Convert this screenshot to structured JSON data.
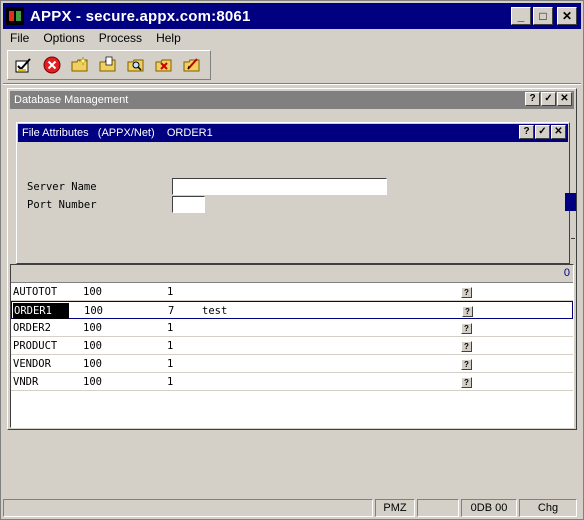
{
  "window": {
    "title": "APPX - secure.appx.com:8061",
    "minimize": "_",
    "maximize": "□",
    "close": "✕"
  },
  "menu": [
    {
      "label": "File"
    },
    {
      "label": "Options"
    },
    {
      "label": "Process"
    },
    {
      "label": "Help"
    }
  ],
  "toolbar": {
    "icons": [
      "confirm-icon",
      "cancel-icon",
      "folder-new-icon",
      "folder-open-icon",
      "folder-search-icon",
      "folder-delete-icon",
      "folder-edit-icon"
    ]
  },
  "db_window": {
    "title": "Database Management",
    "help": "?",
    "ok": "✓",
    "close": "✕"
  },
  "file_attributes": {
    "title": "File Attributes   (APPX/Net)    ORDER1",
    "help": "?",
    "ok": "✓",
    "close": "✕",
    "server_name_label": "Server Name",
    "server_name_value": "",
    "port_number_label": "Port Number",
    "port_number_value": ""
  },
  "table": {
    "header_count": "0",
    "rows": [
      {
        "name": "AUTOTOT",
        "size": "100",
        "n": "1",
        "desc": "",
        "help": "?"
      },
      {
        "name": "ORDER1",
        "size": "100",
        "n": "7",
        "desc": "test",
        "help": "?"
      },
      {
        "name": "ORDER2",
        "size": "100",
        "n": "1",
        "desc": "",
        "help": "?"
      },
      {
        "name": "PRODUCT",
        "size": "100",
        "n": "1",
        "desc": "",
        "help": "?"
      },
      {
        "name": "VENDOR",
        "size": "100",
        "n": "1",
        "desc": "",
        "help": "?"
      },
      {
        "name": "VNDR",
        "size": "100",
        "n": "1",
        "desc": "",
        "help": "?"
      }
    ]
  },
  "status": {
    "mode": "PMZ",
    "db": "0DB 00",
    "chg": "Chg"
  },
  "colors": {
    "title_active": "#000080",
    "title_inactive": "#808080",
    "face": "#d4d0c8"
  }
}
